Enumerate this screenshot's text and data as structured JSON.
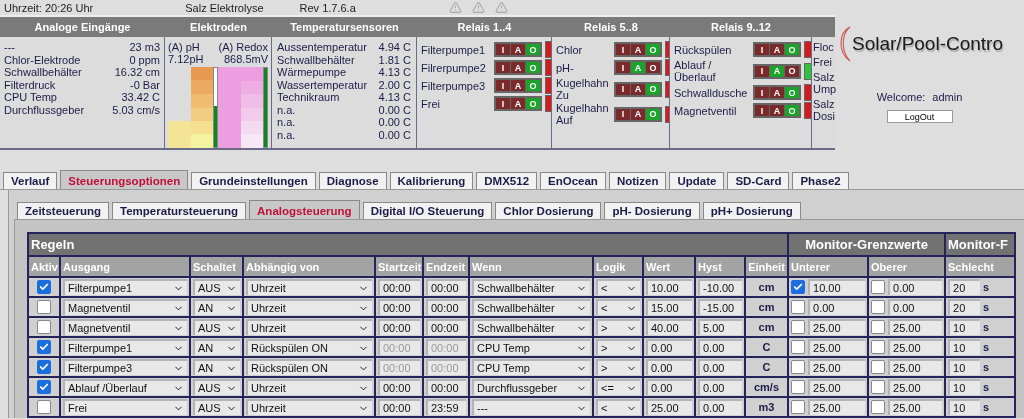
{
  "top_bar": {
    "time": "Uhrzeit: 20:26 Uhr",
    "title": "Salz Elektrolyse",
    "revision": "Rev 1.7.6.a"
  },
  "status_panel": {
    "analog_inputs": {
      "title": "Analoge Eingänge",
      "rows": [
        {
          "label": "---",
          "value": "23 m3"
        },
        {
          "label": "Chlor-Elektrode",
          "value": "0 ppm"
        },
        {
          "label": "Schwallbehälter",
          "value": "16.32 cm"
        },
        {
          "label": "Filterdruck",
          "value": "-0 Bar"
        },
        {
          "label": "CPU Temp",
          "value": "33.42 C"
        },
        {
          "label": "Durchflussgeber",
          "value": "5.03 cm/s"
        }
      ]
    },
    "electrodes": {
      "title": "Elektroden",
      "items": [
        {
          "kind": "ph",
          "label": "(A) pH",
          "reading": "7.12pH",
          "level": 0.52
        },
        {
          "kind": "redox",
          "label": "(A) Redox",
          "reading": "868.5mV",
          "level": 1
        }
      ]
    },
    "temperature_sensors": {
      "title": "Temperatursensoren",
      "rows": [
        {
          "label": "Aussentemperatur",
          "value": "4.94 C"
        },
        {
          "label": "Schwallbehälter",
          "value": "1.81 C"
        },
        {
          "label": "Wärmepumpe",
          "value": "4.13 C"
        },
        {
          "label": "Wassertemperatur",
          "value": "2.00 C"
        },
        {
          "label": "Technikraum",
          "value": "4.13 C"
        },
        {
          "label": "n.a.",
          "value": "0.00 C"
        },
        {
          "label": "n.a.",
          "value": "0.00 C"
        },
        {
          "label": "n.a.",
          "value": "0.00 C"
        }
      ]
    },
    "relay_groups": [
      {
        "title": "Relais 1..4",
        "relays": [
          {
            "name": "Filterpumpe1",
            "on": false,
            "switches": [
              {
                "label": "I",
                "selected": false
              },
              {
                "label": "A",
                "selected": false
              },
              {
                "label": "O",
                "selected": true
              }
            ]
          },
          {
            "name": "Filrerpumpe2",
            "on": false,
            "switches": [
              {
                "label": "I",
                "selected": false
              },
              {
                "label": "A",
                "selected": false
              },
              {
                "label": "O",
                "selected": true
              }
            ]
          },
          {
            "name": "Filterpumpe3",
            "on": false,
            "switches": [
              {
                "label": "I",
                "selected": false
              },
              {
                "label": "A",
                "selected": false
              },
              {
                "label": "O",
                "selected": true
              }
            ]
          },
          {
            "name": "Frei",
            "on": false,
            "switches": [
              {
                "label": "I",
                "selected": false
              },
              {
                "label": "A",
                "selected": false
              },
              {
                "label": "O",
                "selected": true
              }
            ]
          }
        ]
      },
      {
        "title": "Relais 5..8",
        "relays": [
          {
            "name": "Chlor",
            "on": false,
            "switches": [
              {
                "label": "I",
                "selected": false
              },
              {
                "label": "A",
                "selected": false
              },
              {
                "label": "O",
                "selected": true
              }
            ]
          },
          {
            "name": "pH-",
            "on": false,
            "switches": [
              {
                "label": "I",
                "selected": false
              },
              {
                "label": "A",
                "selected": true
              },
              {
                "label": "O",
                "selected": false
              }
            ]
          },
          {
            "name": "Kugelhahn Zu",
            "on": false,
            "switches": [
              {
                "label": "I",
                "selected": false
              },
              {
                "label": "A",
                "selected": false
              },
              {
                "label": "O",
                "selected": true
              }
            ]
          },
          {
            "name": "Kugelhahn Auf",
            "on": false,
            "switches": [
              {
                "label": "I",
                "selected": false
              },
              {
                "label": "A",
                "selected": false
              },
              {
                "label": "O",
                "selected": true
              }
            ]
          }
        ]
      },
      {
        "title": "Relais 9..12",
        "relays": [
          {
            "name": "Rückspülen",
            "on": false,
            "switches": [
              {
                "label": "I",
                "selected": false
              },
              {
                "label": "A",
                "selected": false
              },
              {
                "label": "O",
                "selected": true
              }
            ]
          },
          {
            "name": "Ablauf /Überlauf",
            "on": true,
            "switches": [
              {
                "label": "I",
                "selected": false
              },
              {
                "label": "A",
                "selected": true
              },
              {
                "label": "O",
                "selected": false
              }
            ]
          },
          {
            "name": "Schwalldusche",
            "on": false,
            "switches": [
              {
                "label": "I",
                "selected": false
              },
              {
                "label": "A",
                "selected": false
              },
              {
                "label": "O",
                "selected": true
              }
            ]
          },
          {
            "name": "Magnetventil",
            "on": false,
            "switches": [
              {
                "label": "I",
                "selected": false
              },
              {
                "label": "A",
                "selected": false
              },
              {
                "label": "O",
                "selected": true
              }
            ]
          }
        ]
      }
    ],
    "cut_column": [
      "Floc",
      "Frei",
      "Salz Ump",
      "Salz Dosi"
    ]
  },
  "login": {
    "logo": "Solar/Pool-Contro",
    "welcome": "Welcome:",
    "user": "admin",
    "logout": "LogOut"
  },
  "tabs": [
    {
      "label": "Verlauf",
      "selected": false
    },
    {
      "label": "Steuerungsoptionen",
      "selected": true
    },
    {
      "label": "Grundeinstellungen",
      "selected": false
    },
    {
      "label": "Diagnose",
      "selected": false
    },
    {
      "label": "Kalibrierung",
      "selected": false
    },
    {
      "label": "DMX512",
      "selected": false
    },
    {
      "label": "EnOcean",
      "selected": false
    },
    {
      "label": "Notizen",
      "selected": false
    },
    {
      "label": "Update",
      "selected": false
    },
    {
      "label": "SD-Card",
      "selected": false
    },
    {
      "label": "Phase2",
      "selected": false
    }
  ],
  "subtabs": [
    {
      "label": "Zeitsteuerung",
      "selected": false
    },
    {
      "label": "Temperatursteuerung",
      "selected": false
    },
    {
      "label": "Analogsteuerung",
      "selected": true
    },
    {
      "label": "Digital I/O Steuerung",
      "selected": false
    },
    {
      "label": "Chlor Dosierung",
      "selected": false
    },
    {
      "label": "pH- Dosierung",
      "selected": false
    },
    {
      "label": "pH+ Dosierung",
      "selected": false
    }
  ],
  "table": {
    "title": "Regeln",
    "groups": [
      "Monitor-Grenzwerte",
      "Monitor-F"
    ],
    "columns": [
      "Aktiv",
      "Ausgang",
      "Schaltet",
      "Abhängig von",
      "Startzeit",
      "Endzeit",
      "Wenn",
      "Logik",
      "Wert",
      "Hyst",
      "Einheit",
      "Unterer",
      "Oberer",
      "Schlecht"
    ],
    "rows": [
      {
        "checked": true,
        "output": "Filterpumpe1",
        "switch": "AUS",
        "depends": "Uhrzeit",
        "start": "00:00",
        "end": "00:00",
        "times_disabled": false,
        "when": "Schwallbehälter",
        "logic": "<",
        "value": "10.00",
        "hyst": "-10.00",
        "unit": "cm",
        "lower_checked": true,
        "lower": "10.00",
        "upper_checked": false,
        "upper": "0.00",
        "bad": "20",
        "bad_unit": "s"
      },
      {
        "checked": false,
        "output": "Magnetventil",
        "switch": "AN",
        "depends": "Uhrzeit",
        "start": "00:00",
        "end": "00:00",
        "times_disabled": false,
        "when": "Schwallbehälter",
        "logic": "<",
        "value": "15.00",
        "hyst": "-15.00",
        "unit": "cm",
        "lower_checked": false,
        "lower": "0.00",
        "upper_checked": false,
        "upper": "0.00",
        "bad": "20",
        "bad_unit": "s"
      },
      {
        "checked": false,
        "output": "Magnetventil",
        "switch": "AUS",
        "depends": "Uhrzeit",
        "start": "00:00",
        "end": "00:00",
        "times_disabled": false,
        "when": "Schwallbehälter",
        "logic": ">",
        "value": "40.00",
        "hyst": "5.00",
        "unit": "cm",
        "lower_checked": false,
        "lower": "25.00",
        "upper_checked": false,
        "upper": "25.00",
        "bad": "10",
        "bad_unit": "s"
      },
      {
        "checked": true,
        "output": "Filterpumpe1",
        "switch": "AN",
        "depends": "Rückspülen ON",
        "start": "00:00",
        "end": "00:00",
        "times_disabled": true,
        "when": "CPU Temp",
        "logic": ">",
        "value": "0.00",
        "hyst": "0.00",
        "unit": "C",
        "lower_checked": false,
        "lower": "25.00",
        "upper_checked": false,
        "upper": "25.00",
        "bad": "10",
        "bad_unit": "s"
      },
      {
        "checked": true,
        "output": "Filterpumpe3",
        "switch": "AN",
        "depends": "Rückspülen ON",
        "start": "00:00",
        "end": "00:00",
        "times_disabled": true,
        "when": "CPU Temp",
        "logic": ">",
        "value": "0.00",
        "hyst": "0.00",
        "unit": "C",
        "lower_checked": false,
        "lower": "25.00",
        "upper_checked": false,
        "upper": "25.00",
        "bad": "10",
        "bad_unit": "s"
      },
      {
        "checked": true,
        "output": "Ablauf /Überlauf",
        "switch": "AUS",
        "depends": "Uhrzeit",
        "start": "00:00",
        "end": "00:00",
        "times_disabled": false,
        "when": "Durchflussgeber",
        "logic": "<=",
        "value": "0.00",
        "hyst": "0.00",
        "unit": "cm/s",
        "lower_checked": false,
        "lower": "25.00",
        "upper_checked": false,
        "upper": "25.00",
        "bad": "10",
        "bad_unit": "s"
      },
      {
        "checked": false,
        "output": "Frei",
        "switch": "AUS",
        "depends": "Uhrzeit",
        "start": "00:00",
        "end": "23:59",
        "times_disabled": false,
        "when": "---",
        "logic": "<",
        "value": "25.00",
        "hyst": "0.00",
        "unit": "m3",
        "lower_checked": false,
        "lower": "25.00",
        "upper_checked": false,
        "upper": "25.00",
        "bad": "10",
        "bad_unit": "s"
      }
    ]
  }
}
